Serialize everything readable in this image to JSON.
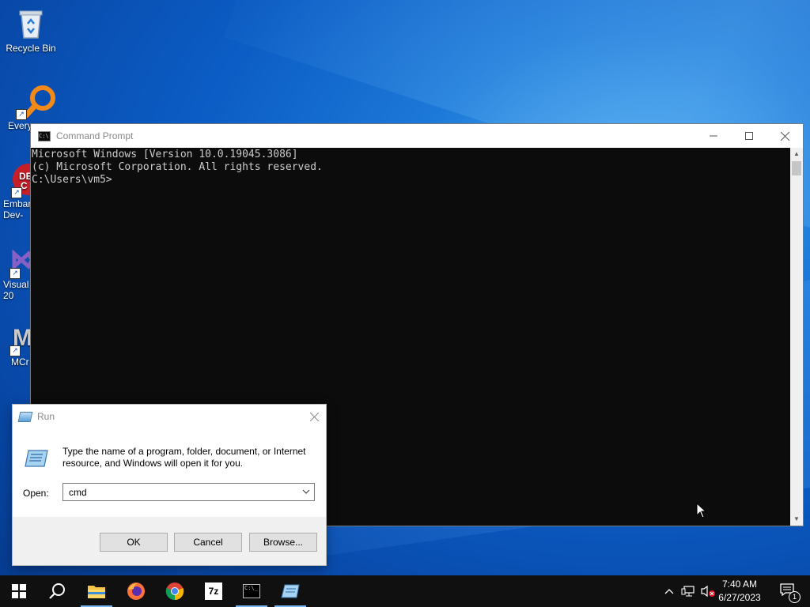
{
  "desktop": {
    "icons": [
      {
        "label": "Recycle Bin",
        "icon": "recycle-bin-icon"
      },
      {
        "label": "Every",
        "icon": "everything-search-icon"
      },
      {
        "label": "Embar\nDev-",
        "icon": "embarcadero-dev-icon"
      },
      {
        "label": "Visual\n20",
        "icon": "visual-studio-icon"
      },
      {
        "label": "MCr",
        "icon": "mcreator-icon"
      }
    ]
  },
  "cmd_window": {
    "title": "Command Prompt",
    "lines": [
      "Microsoft Windows [Version 10.0.19045.3086]",
      "(c) Microsoft Corporation. All rights reserved.",
      "",
      "C:\\Users\\vm5>"
    ]
  },
  "run_dialog": {
    "title": "Run",
    "description": "Type the name of a program, folder, document, or Internet resource, and Windows will open it for you.",
    "open_label": "Open:",
    "open_value": "cmd",
    "ok_label": "OK",
    "cancel_label": "Cancel",
    "browse_label": "Browse..."
  },
  "taskbar": {
    "apps": [
      "start-icon",
      "search-icon",
      "file-explorer-icon",
      "firefox-icon",
      "chrome-icon",
      "7zip-icon",
      "command-prompt-icon",
      "run-icon"
    ],
    "tray": {
      "time": "7:40 AM",
      "date": "6/27/2023",
      "notification_count": "1"
    }
  },
  "colors": {
    "console_bg": "#0c0c0c",
    "console_text": "#cccccc",
    "accent": "#0078d7"
  }
}
